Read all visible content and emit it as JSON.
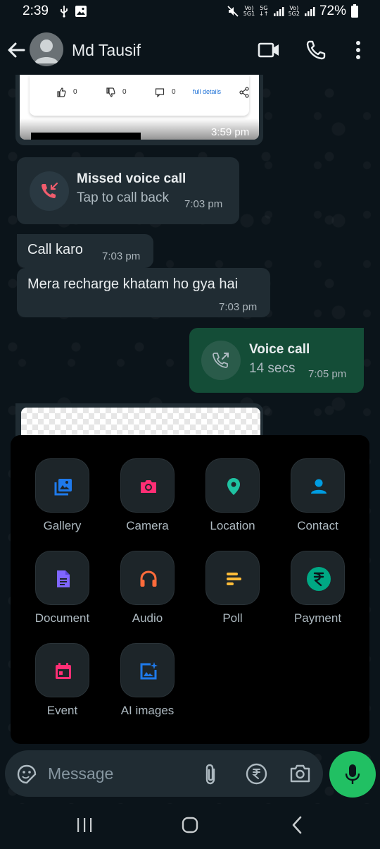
{
  "status_bar": {
    "time": "2:39",
    "battery": "72%"
  },
  "header": {
    "contact_name": "Md Tausif",
    "icons": [
      "back-arrow-icon",
      "avatar",
      "video-call-icon",
      "voice-call-icon",
      "more-options-icon"
    ]
  },
  "preview_card": {
    "like_count": "0",
    "dislike_count": "0",
    "comment_count": "0",
    "link_text": "full details",
    "time": "3:59 pm"
  },
  "messages": [
    {
      "type": "missed_call",
      "title": "Missed voice call",
      "subtitle": "Tap to call back",
      "time": "7:03 pm"
    },
    {
      "type": "text",
      "text": "Call karo",
      "time": "7:03 pm"
    },
    {
      "type": "text",
      "text": "Mera recharge khatam ho gya hai",
      "time": "7:03 pm"
    },
    {
      "type": "voice_call_out",
      "title": "Voice call",
      "subtitle": "14 secs",
      "time": "7:05 pm"
    }
  ],
  "attach_menu": {
    "items": [
      {
        "label": "Gallery",
        "icon": "gallery-icon",
        "color": "#1f7aeb"
      },
      {
        "label": "Camera",
        "icon": "camera-icon",
        "color": "#ff2e74"
      },
      {
        "label": "Location",
        "icon": "location-pin-icon",
        "color": "#1fc2a1"
      },
      {
        "label": "Contact",
        "icon": "contact-person-icon",
        "color": "#009de2"
      },
      {
        "label": "Document",
        "icon": "document-icon",
        "color": "#7f66ff"
      },
      {
        "label": "Audio",
        "icon": "headphones-icon",
        "color": "#ff6b3b"
      },
      {
        "label": "Poll",
        "icon": "poll-icon",
        "color": "#ffbc38"
      },
      {
        "label": "Payment",
        "icon": "rupee-icon",
        "color": "#00a884"
      },
      {
        "label": "Event",
        "icon": "calendar-icon",
        "color": "#ff2e74"
      },
      {
        "label": "AI images",
        "icon": "ai-image-icon",
        "color": "#1f7aeb"
      }
    ]
  },
  "input": {
    "placeholder": "Message",
    "icons": [
      "emoji-sticker-icon",
      "attach-clip-icon",
      "rupee-payment-icon",
      "camera-icon",
      "mic-icon"
    ]
  },
  "colors": {
    "background": "#0b141a",
    "incoming_bubble": "#202c33",
    "outgoing_bubble": "#144d37",
    "accent_green": "#21c063",
    "missed_red": "#f15c6d"
  }
}
